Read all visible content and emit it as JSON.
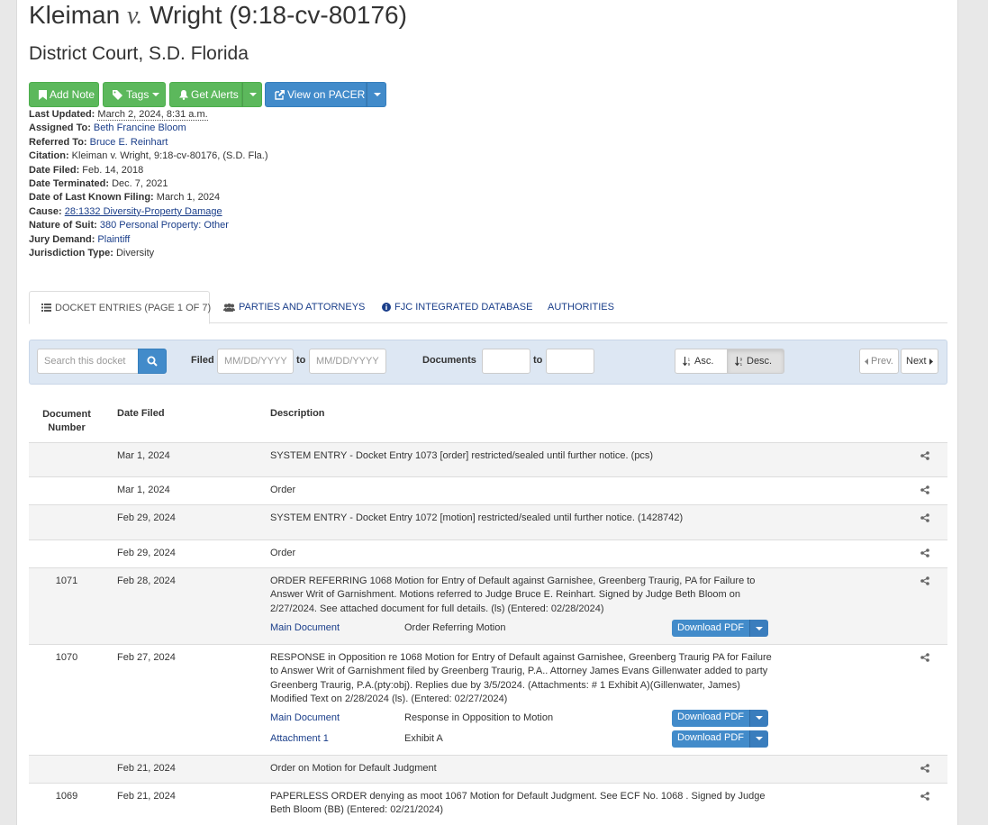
{
  "case": {
    "title_party1": "Kleiman",
    "title_v": "v.",
    "title_party2": "Wright (9:18-cv-80176)",
    "court": "District Court, S.D. Florida"
  },
  "actions": {
    "add_note": "Add Note",
    "tags": "Tags",
    "get_alerts": "Get Alerts",
    "view_pacer": "View on PACER"
  },
  "meta": {
    "last_updated_label": "Last Updated:",
    "last_updated": "March 2, 2024, 8:31 a.m.",
    "assigned_to_label": "Assigned To:",
    "assigned_to": "Beth Francine Bloom",
    "referred_to_label": "Referred To:",
    "referred_to": "Bruce E. Reinhart",
    "citation_label": "Citation:",
    "citation": "Kleiman v. Wright, 9:18-cv-80176, (S.D. Fla.)",
    "date_filed_label": "Date Filed:",
    "date_filed": "Feb. 14, 2018",
    "date_terminated_label": "Date Terminated:",
    "date_terminated": "Dec. 7, 2021",
    "last_known_filing_label": "Date of Last Known Filing:",
    "last_known_filing": "March 1, 2024",
    "cause_label": "Cause:",
    "cause": "28:1332 Diversity-Property Damage",
    "nature_label": "Nature of Suit:",
    "nature": "380 Personal Property: Other",
    "jury_label": "Jury Demand:",
    "jury": "Plaintiff",
    "jurisdiction_label": "Jurisdiction Type:",
    "jurisdiction": "Diversity"
  },
  "tabs": [
    {
      "label": "Docket Entries (Page 1 of 7)",
      "icon": "list-icon"
    },
    {
      "label": "Parties and Attorneys",
      "icon": "users-icon"
    },
    {
      "label": "FJC Integrated Database",
      "icon": "info-circle-icon"
    },
    {
      "label": "Authorities",
      "icon": ""
    }
  ],
  "filter": {
    "search_placeholder": "Search this docket",
    "filed_label": "Filed",
    "date_placeholder": "MM/DD/YYYY",
    "to_label": "to",
    "documents_label": "Documents",
    "asc_label": "Asc.",
    "desc_label": "Desc.",
    "prev_label": "Prev.",
    "next_label": "Next"
  },
  "table": {
    "col_number": "Document Number",
    "col_date": "Date Filed",
    "col_desc": "Description",
    "download_label": "Download PDF",
    "rows": [
      {
        "num": "",
        "date": "Mar 1, 2024",
        "desc": "SYSTEM ENTRY - Docket Entry 1073 [order] restricted/sealed until further notice. (pcs)"
      },
      {
        "num": "",
        "date": "Mar 1, 2024",
        "desc": "Order"
      },
      {
        "num": "",
        "date": "Feb 29, 2024",
        "desc": "SYSTEM ENTRY - Docket Entry 1072 [motion] restricted/sealed until further notice. (1428742)"
      },
      {
        "num": "",
        "date": "Feb 29, 2024",
        "desc": "Order"
      },
      {
        "num": "1071",
        "date": "Feb 28, 2024",
        "desc": "ORDER REFERRING 1068 Motion for Entry of Default against Garnishee, Greenberg Traurig, PA for Failure to Answer Writ of Garnishment. Motions referred to Judge Bruce E. Reinhart. Signed by Judge Beth Bloom on 2/27/2024. See attached document for full details. (ls) (Entered: 02/28/2024)",
        "docs": [
          {
            "link": "Main Document",
            "type": "Order Referring Motion"
          }
        ]
      },
      {
        "num": "1070",
        "date": "Feb 27, 2024",
        "desc": "RESPONSE in Opposition re 1068 Motion for Entry of Default against Garnishee, Greenberg Traurig PA for Failure to Answer Writ of Garnishment filed by Greenberg Traurig, P.A.. Attorney James Evans Gillenwater added to party Greenberg Traurig, P.A.(pty:obj). Replies due by 3/5/2024. (Attachments: # 1 Exhibit A)(Gillenwater, James) Modified Text on 2/28/2024 (ls). (Entered: 02/27/2024)",
        "docs": [
          {
            "link": "Main Document",
            "type": "Response in Opposition to Motion"
          },
          {
            "link": "Attachment 1",
            "type": "Exhibit A"
          }
        ]
      },
      {
        "num": "",
        "date": "Feb 21, 2024",
        "desc": "Order on Motion for Default Judgment"
      },
      {
        "num": "1069",
        "date": "Feb 21, 2024",
        "desc": "PAPERLESS ORDER denying as moot 1067 Motion for Default Judgment. See ECF No. 1068 . Signed by Judge Beth Bloom (BB) (Entered: 02/21/2024)"
      }
    ]
  }
}
